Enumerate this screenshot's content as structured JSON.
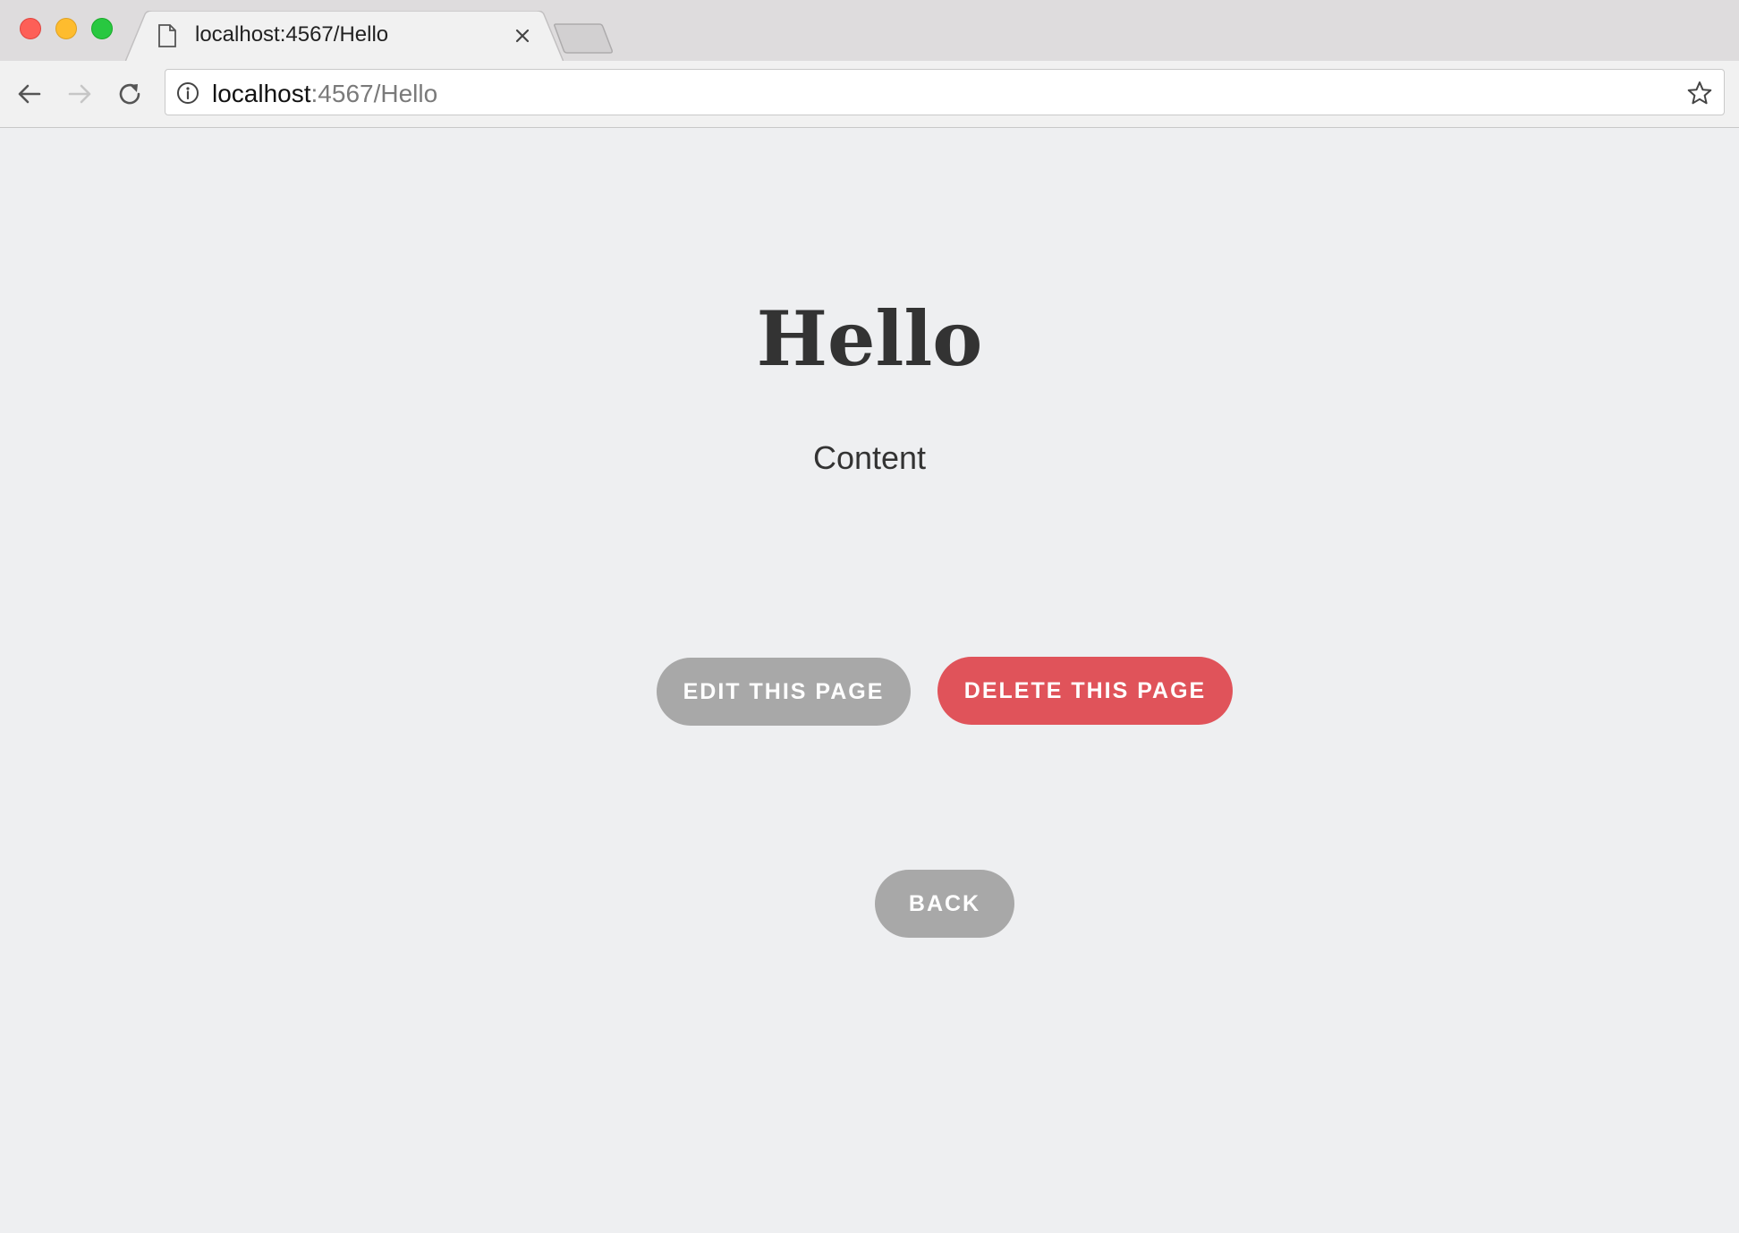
{
  "browser": {
    "tab": {
      "title": "localhost:4567/Hello"
    },
    "address_bar": {
      "host": "localhost",
      "rest": ":4567/Hello"
    }
  },
  "page": {
    "title": "Hello",
    "content": "Content",
    "buttons": {
      "edit": "EDIT THIS PAGE",
      "delete": "DELETE THIS PAGE",
      "back": "BACK"
    }
  },
  "colors": {
    "background": "#eeeff1",
    "edit_button": "#a8a8a8",
    "delete_button": "#e0535a",
    "back_button": "#a8a8a8"
  },
  "icons": [
    "close-icon",
    "minimize-icon",
    "zoom-icon",
    "document-icon",
    "tab-close-icon",
    "back-arrow-icon",
    "forward-arrow-icon",
    "reload-icon",
    "info-icon",
    "star-icon"
  ]
}
